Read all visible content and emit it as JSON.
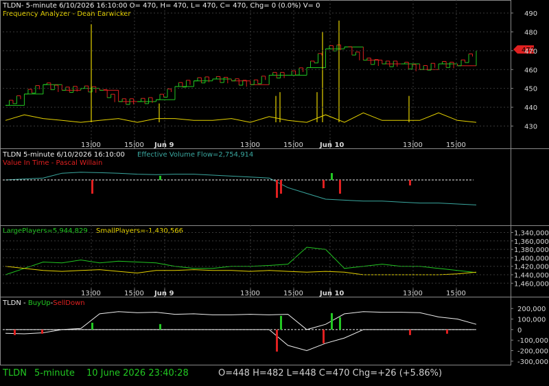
{
  "colors": {
    "background": "#000000",
    "grid": "#3a3a3a",
    "frame": "#8a8a8a",
    "up_green": "#22c822",
    "down_red": "#e02020",
    "yellow": "#e8d400",
    "orange": "#ff9933",
    "white": "#f0f0f0",
    "teal": "#3aa8a0",
    "axis_text": "#d8d8d8",
    "status_green": "#22c822"
  },
  "panels": {
    "price": {
      "title_line": "TLDN- 5-minute 6/10/2026 16:10:00 O= 470, H= 470, L= 470, C= 470, Chg= 0 (0.0%) V= 0",
      "indicator_label": "Frequency Analyzer - Dean Earwicker",
      "last_price_tag": "470",
      "y_ticks": [
        "490",
        "480",
        "470",
        "460",
        "450",
        "440",
        "430"
      ],
      "x_ticks": [
        {
          "label": "13:00",
          "bold": false
        },
        {
          "label": "15:00",
          "bold": false
        },
        {
          "label": "Jun 9",
          "bold": true
        },
        {
          "label": "13:00",
          "bold": false
        },
        {
          "label": "15:00",
          "bold": false
        },
        {
          "label": "Jun 10",
          "bold": true
        },
        {
          "label": "13:00",
          "bold": false
        },
        {
          "label": "15:00",
          "bold": false
        }
      ]
    },
    "volume": {
      "title": "TLDN 5-minute  6/10/2026 16:10:00",
      "evf_label": "Effective Volume Flow=2,754,914",
      "value_label": "Value In Time - Pascal Willain"
    },
    "players": {
      "large_label": "LargePlayers=5,944,829",
      "small_label": "SmallPlayers=-1,430,566",
      "y_ticks": [
        "1,340,000",
        "1,360,000",
        "1,380,000",
        "1,400,000",
        "1,420,000",
        "1,440,000",
        "1,460,000"
      ],
      "x_ticks": [
        {
          "label": "13:00",
          "bold": false
        },
        {
          "label": "15:00",
          "bold": false
        },
        {
          "label": "Jun 9",
          "bold": true
        },
        {
          "label": "13:00",
          "bold": false
        },
        {
          "label": "15:00",
          "bold": false
        },
        {
          "label": "Jun 10",
          "bold": true
        },
        {
          "label": "13:00",
          "bold": false
        },
        {
          "label": "15:00",
          "bold": false
        }
      ]
    },
    "buyup": {
      "prefix": "TLDN - ",
      "buy": "BuyUp",
      "sep": "-",
      "sell": "SellDown",
      "y_ticks": [
        "200,000",
        "100,000",
        "0",
        "-100,000",
        "-200,000",
        "-300,000"
      ]
    }
  },
  "status": {
    "symbol": "TLDN",
    "interval": "5-minute",
    "datetime": "10 June 2026 23:40:28",
    "ohlc": "O=448  H=482  L=448  C=470  Chg=+26 (+5.86%)"
  },
  "chart_data": [
    {
      "type": "line",
      "name": "price",
      "title": "TLDN- 5-minute 6/10/2026 16:10:00 O= 470, H= 470, L= 470, C= 470, Chg= 0 (0.0%) V= 0",
      "ylim": [
        424,
        494
      ],
      "x": [
        0,
        4,
        8,
        12,
        16,
        20,
        24,
        28,
        32,
        36,
        40,
        44,
        48,
        52,
        56,
        60,
        64,
        68,
        72,
        76,
        80,
        84,
        88,
        92,
        96,
        100
      ],
      "series": [
        {
          "name": "",
          "values": [
            441,
            447,
            452,
            449,
            450,
            449,
            443,
            443,
            444,
            451,
            454,
            455,
            454,
            452,
            457,
            457,
            461,
            471,
            472,
            465,
            463,
            463,
            460,
            463,
            462,
            470
          ]
        },
        {
          "name": "Frequency Analyzer - Dean Earwicker",
          "values": [
            433,
            436,
            434,
            433,
            432,
            433,
            434,
            432,
            434,
            434,
            433,
            433,
            434,
            432,
            435,
            433,
            432,
            436,
            432,
            437,
            433,
            433,
            433,
            437,
            433,
            432
          ]
        }
      ],
      "last_price": 470
    },
    {
      "type": "line",
      "name": "volume",
      "series": [
        {
          "name": "Effective Volume Flow",
          "values": [
            0,
            -0.05,
            -0.1,
            -0.35,
            -0.4,
            -0.38,
            -0.35,
            -0.3,
            -0.28,
            -0.3,
            -0.3,
            -0.25,
            -0.2,
            -0.15,
            -0.1,
            0.4,
            0.7,
            1.0,
            1.05,
            1.1,
            1.1,
            1.15,
            1.2,
            1.2,
            1.25,
            1.3
          ]
        },
        {
          "name": "Value In Time - Pascal Willain",
          "values": [
            0,
            0,
            0,
            0,
            0,
            0,
            0,
            0,
            0,
            0,
            0,
            0,
            0,
            0,
            0,
            0,
            0,
            0,
            0,
            0,
            0,
            0,
            0,
            0,
            0,
            0
          ]
        }
      ]
    },
    {
      "type": "line",
      "name": "players",
      "ylim": [
        1336000,
        1466000
      ],
      "series": [
        {
          "name": "LargePlayers",
          "values": [
            1440000,
            1425000,
            1410000,
            1412000,
            1405000,
            1412000,
            1408000,
            1410000,
            1412000,
            1420000,
            1425000,
            1425000,
            1420000,
            1420000,
            1418000,
            1415000,
            1375000,
            1380000,
            1425000,
            1420000,
            1415000,
            1420000,
            1420000,
            1425000,
            1430000,
            1435000
          ]
        },
        {
          "name": "SmallPlayers",
          "values": [
            1420000,
            1425000,
            1430000,
            1432000,
            1430000,
            1428000,
            1432000,
            1436000,
            1430000,
            1430000,
            1428000,
            1430000,
            1430000,
            1432000,
            1430000,
            1432000,
            1434000,
            1432000,
            1434000,
            1440000,
            1440000,
            1440000,
            1440000,
            1440000,
            1438000,
            1434000
          ]
        }
      ]
    },
    {
      "type": "line",
      "name": "buyup_selldown",
      "ylim": [
        -340000,
        260000
      ],
      "series": [
        {
          "name": "BuyUp",
          "values": [
            -35000,
            -40000,
            -30000,
            0,
            10000,
            150000,
            170000,
            160000,
            165000,
            145000,
            150000,
            140000,
            140000,
            145000,
            140000,
            145000,
            0,
            50000,
            150000,
            170000,
            165000,
            165000,
            160000,
            120000,
            100000,
            50000
          ]
        },
        {
          "name": "SellDown",
          "values": [
            0,
            0,
            0,
            0,
            0,
            0,
            0,
            0,
            0,
            0,
            0,
            0,
            0,
            0,
            0,
            -150000,
            -200000,
            -130000,
            -80000,
            0,
            0,
            0,
            0,
            0,
            0,
            0
          ]
        }
      ]
    }
  ]
}
